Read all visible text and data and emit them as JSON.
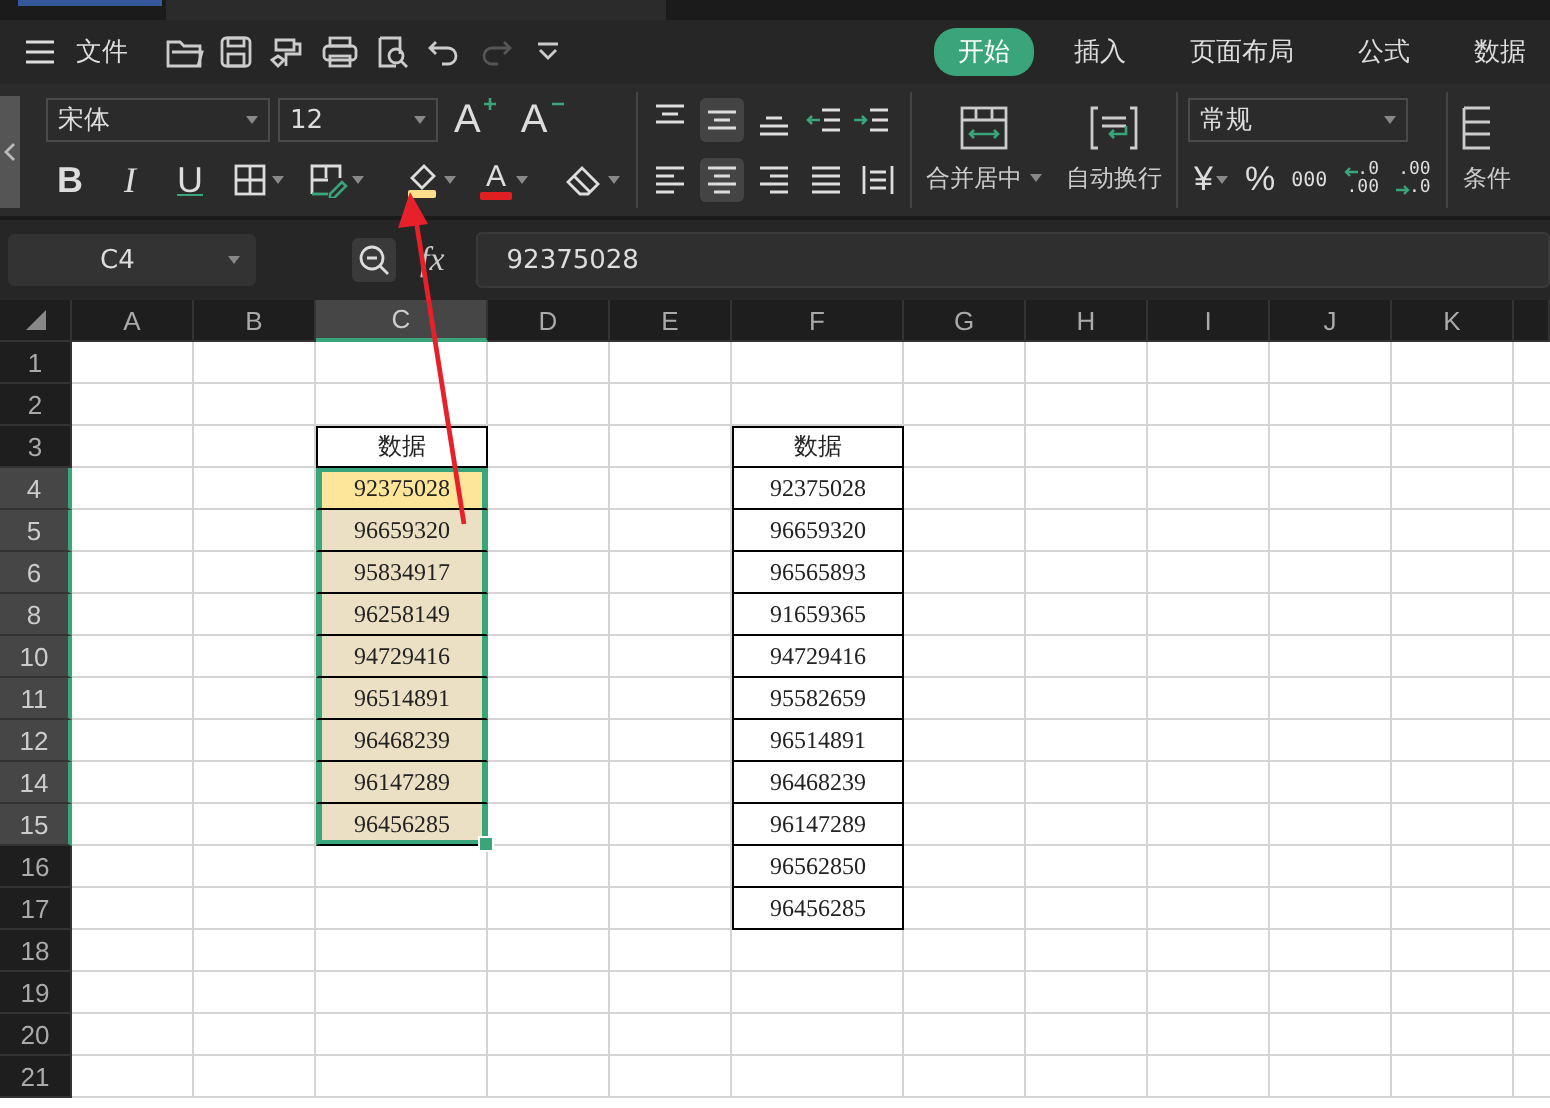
{
  "title_bar": {
    "menu": "文件",
    "quick_access": [
      {
        "kind": "open",
        "disabled": false
      },
      {
        "kind": "save",
        "disabled": false
      },
      {
        "kind": "painter",
        "disabled": false
      },
      {
        "kind": "print",
        "disabled": false
      },
      {
        "kind": "preview",
        "disabled": false
      },
      {
        "kind": "undo",
        "disabled": false
      },
      {
        "kind": "redo",
        "disabled": true
      },
      {
        "kind": "more",
        "disabled": false
      }
    ],
    "tabs": [
      {
        "label": "开始",
        "selected": true
      },
      {
        "label": "插入",
        "selected": false
      },
      {
        "label": "页面布局",
        "selected": false
      },
      {
        "label": "公式",
        "selected": false
      },
      {
        "label": "数据",
        "selected": false
      }
    ]
  },
  "ribbon": {
    "font_name": "宋体",
    "font_size": "12",
    "font_size_buttons": [
      {
        "kind": "grow",
        "label": "A"
      },
      {
        "kind": "shrink",
        "label": "A"
      }
    ],
    "style_buttons": [
      {
        "kind": "bold",
        "label": "B"
      },
      {
        "kind": "italic",
        "label": "I"
      },
      {
        "kind": "underline",
        "label": "U"
      }
    ],
    "format_buttons": [
      {
        "kind": "borders"
      },
      {
        "kind": "border_draw"
      },
      {
        "kind": "fill",
        "color": "#ffe08a"
      },
      {
        "kind": "font_color",
        "label": "A",
        "color": "#e02020"
      },
      {
        "kind": "clear"
      }
    ],
    "vertical_align": [
      {
        "kind": "top",
        "selected": false
      },
      {
        "kind": "middle",
        "selected": true
      },
      {
        "kind": "bottom",
        "selected": false
      }
    ],
    "indent": [
      {
        "kind": "decrease"
      },
      {
        "kind": "increase"
      }
    ],
    "horizontal_align": [
      {
        "kind": "left",
        "selected": false
      },
      {
        "kind": "center",
        "selected": true
      },
      {
        "kind": "right",
        "selected": false
      },
      {
        "kind": "justify",
        "selected": false
      },
      {
        "kind": "distributed",
        "selected": false
      }
    ],
    "merge_button": "合并居中",
    "wrap_button": "自动换行",
    "number_format": "常规",
    "number_buttons": [
      {
        "kind": "currency",
        "label": "¥"
      },
      {
        "kind": "percent",
        "label": "%"
      },
      {
        "kind": "thousands",
        "label": "000"
      },
      {
        "kind": "decimal_increase",
        "lines": [
          ".0",
          ".00"
        ]
      },
      {
        "kind": "decimal_decrease",
        "lines": [
          ".00",
          ".0"
        ]
      }
    ],
    "conditional_button": "条件"
  },
  "formula_bar": {
    "name_box": "C4",
    "function_label": "fx",
    "value": "92375028"
  },
  "sheet": {
    "columns": [
      {
        "label": "A",
        "selected": false
      },
      {
        "label": "B",
        "selected": false
      },
      {
        "label": "C",
        "selected": true
      },
      {
        "label": "D",
        "selected": false
      },
      {
        "label": "E",
        "selected": false
      },
      {
        "label": "F",
        "selected": false
      },
      {
        "label": "G",
        "selected": false
      },
      {
        "label": "H",
        "selected": false
      },
      {
        "label": "I",
        "selected": false
      },
      {
        "label": "J",
        "selected": false
      },
      {
        "label": "K",
        "selected": false
      }
    ],
    "rows": [
      {
        "label": "1",
        "selected": false
      },
      {
        "label": "2",
        "selected": false
      },
      {
        "label": "3",
        "selected": false
      },
      {
        "label": "4",
        "selected": true
      },
      {
        "label": "5",
        "selected": true
      },
      {
        "label": "6",
        "selected": true
      },
      {
        "label": "8",
        "selected": true
      },
      {
        "label": "10",
        "selected": true
      },
      {
        "label": "11",
        "selected": true
      },
      {
        "label": "12",
        "selected": true
      },
      {
        "label": "14",
        "selected": true
      },
      {
        "label": "15",
        "selected": true
      },
      {
        "label": "16",
        "selected": false
      },
      {
        "label": "17",
        "selected": false
      },
      {
        "label": "18",
        "selected": false
      },
      {
        "label": "19",
        "selected": false
      },
      {
        "label": "20",
        "selected": false
      },
      {
        "label": "21",
        "selected": false
      }
    ],
    "table_1": {
      "header": "数据",
      "cells": [
        {
          "value": "92375028",
          "selected": true,
          "active": true
        },
        {
          "value": "96659320",
          "selected": true,
          "active": false
        },
        {
          "value": "95834917",
          "selected": true,
          "active": false
        },
        {
          "value": "96258149",
          "selected": true,
          "active": false
        },
        {
          "value": "94729416",
          "selected": true,
          "active": false
        },
        {
          "value": "96514891",
          "selected": true,
          "active": false
        },
        {
          "value": "96468239",
          "selected": true,
          "active": false
        },
        {
          "value": "96147289",
          "selected": true,
          "active": false
        },
        {
          "value": "96456285",
          "selected": true,
          "active": false
        }
      ]
    },
    "table_2": {
      "header": "数据",
      "cells": [
        "92375028",
        "96659320",
        "96565893",
        "91659365",
        "94729416",
        "95582659",
        "96514891",
        "96468239",
        "96147289",
        "96562850",
        "96456285"
      ]
    }
  }
}
